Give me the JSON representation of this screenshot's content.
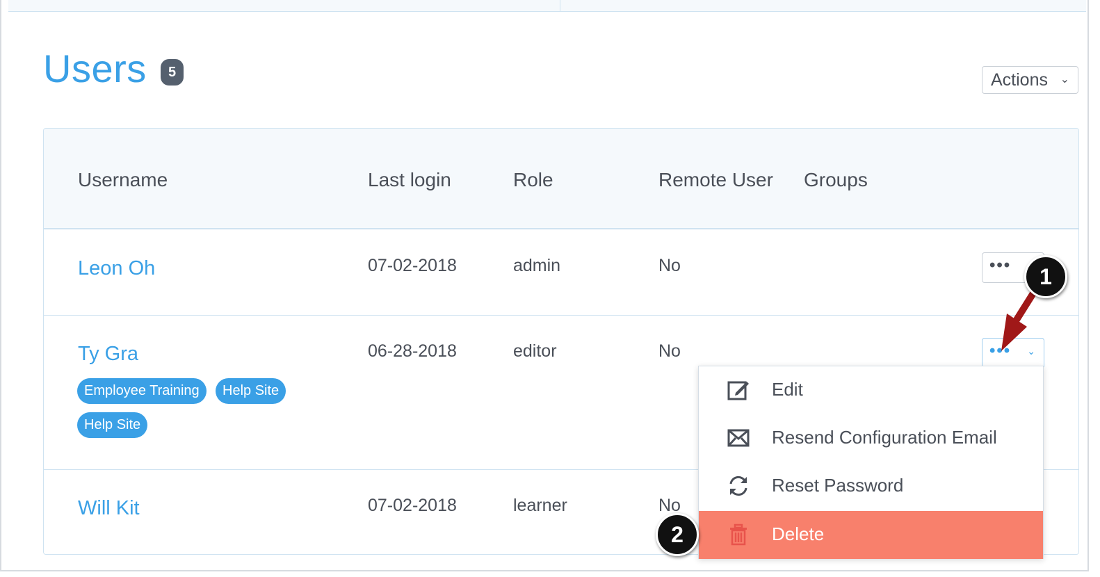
{
  "page": {
    "title": "Users",
    "count": "5",
    "actions_label": "Actions",
    "accent_color": "#3aa0e6",
    "danger_color": "#f8806c"
  },
  "table": {
    "headers": [
      "Username",
      "Last login",
      "Role",
      "Remote User",
      "Groups"
    ],
    "rows": [
      {
        "username": "Leon Oh",
        "last_login": "07-02-2018",
        "role": "admin",
        "remote_user": "No",
        "groups": []
      },
      {
        "username": "Ty Gra",
        "last_login": "06-28-2018",
        "role": "editor",
        "remote_user": "No",
        "groups": [
          "Employee Training",
          "Help Site",
          "Help Site"
        ]
      },
      {
        "username": "Will Kit",
        "last_login": "07-02-2018",
        "role": "learner",
        "remote_user": "No",
        "groups": []
      }
    ]
  },
  "row_menu": {
    "more_icon": "ellipsis-icon",
    "items": [
      {
        "label": "Edit",
        "icon": "edit-icon"
      },
      {
        "label": "Resend Configuration Email",
        "icon": "mail-icon"
      },
      {
        "label": "Reset Password",
        "icon": "refresh-icon"
      },
      {
        "label": "Delete",
        "icon": "trash-icon"
      }
    ]
  },
  "callouts": {
    "first": "1",
    "second": "2"
  }
}
